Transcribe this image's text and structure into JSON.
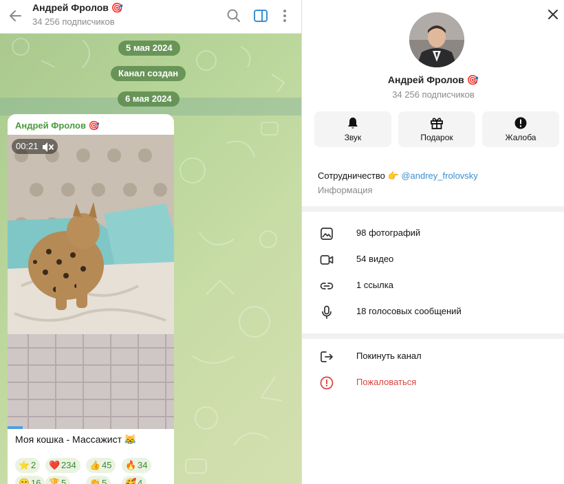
{
  "chat_header": {
    "title": "Андрей Фролов 🎯",
    "subtitle": "34 256 подписчиков"
  },
  "service": {
    "date1": "5 мая 2024",
    "channel_created": "Канал создан",
    "date2": "6 мая 2024"
  },
  "message": {
    "author": "Андрей Фролов 🎯",
    "video_time": "00:21",
    "video_progress": 0.09,
    "text": "Моя кошка - Массажист 😹",
    "reactions": [
      {
        "emoji": "⭐",
        "count": "2"
      },
      {
        "emoji": "❤️",
        "count": "234"
      },
      {
        "emoji": "👍",
        "count": "45"
      },
      {
        "emoji": "🔥",
        "count": "34"
      },
      {
        "emoji": "😁",
        "count": "16"
      },
      {
        "emoji": "🏆",
        "count": "5"
      },
      {
        "emoji": "👏",
        "count": "5"
      },
      {
        "emoji": "🥰",
        "count": "4"
      }
    ]
  },
  "profile": {
    "name": "Андрей Фролов 🎯",
    "subscribers": "34 256 подписчиков",
    "actions": {
      "sound": "Звук",
      "gift": "Подарок",
      "report": "Жалоба"
    },
    "bio_text": "Сотрудничество 👉 ",
    "bio_link": "@andrey_frolovsky",
    "bio_label": "Информация",
    "media": {
      "photos": "98 фотографий",
      "videos": "54 видео",
      "links": "1 ссылка",
      "voice": "18 голосовых сообщений"
    },
    "leave": "Покинуть канал",
    "complain": "Пожаловаться"
  },
  "colors": {
    "accent_blue": "#3a8fd0",
    "author_green": "#4a9a3c",
    "danger_red": "#d9423c",
    "service_pill": "#5c8a4c"
  }
}
